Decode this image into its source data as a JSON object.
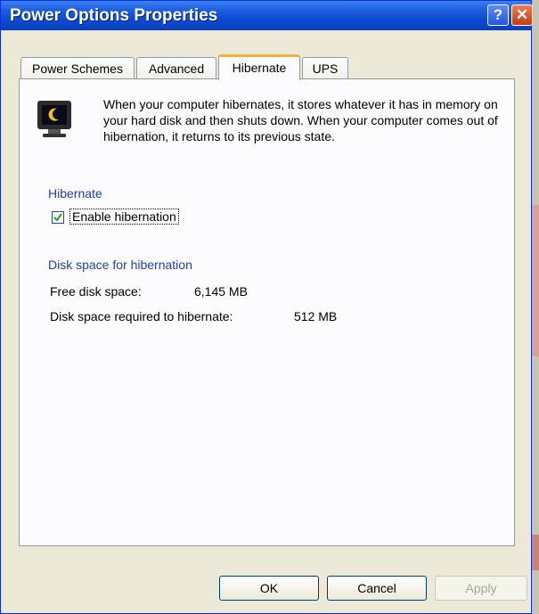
{
  "window": {
    "title": "Power Options Properties",
    "help_glyph": "?",
    "close_glyph": "✕"
  },
  "tabs": [
    {
      "label": "Power Schemes"
    },
    {
      "label": "Advanced"
    },
    {
      "label": "Hibernate"
    },
    {
      "label": "UPS"
    }
  ],
  "active_tab": "Hibernate",
  "hibernate": {
    "description": "When your computer hibernates, it stores whatever it has in memory on your hard disk and then shuts down. When your computer comes out of hibernation, it returns to its previous state.",
    "group_hibernate_label": "Hibernate",
    "enable_label": "Enable hibernation",
    "enable_checked": true,
    "disk_group_label": "Disk space for hibernation",
    "free_space_label": "Free disk space:",
    "free_space_value": "6,145 MB",
    "required_label": "Disk space required to hibernate:",
    "required_value": "512 MB"
  },
  "buttons": {
    "ok": "OK",
    "cancel": "Cancel",
    "apply": "Apply"
  },
  "colors": {
    "titlebar": "#0d4cd6",
    "tab_highlight": "#f7b13a",
    "group_label": "#1f3fa3"
  }
}
